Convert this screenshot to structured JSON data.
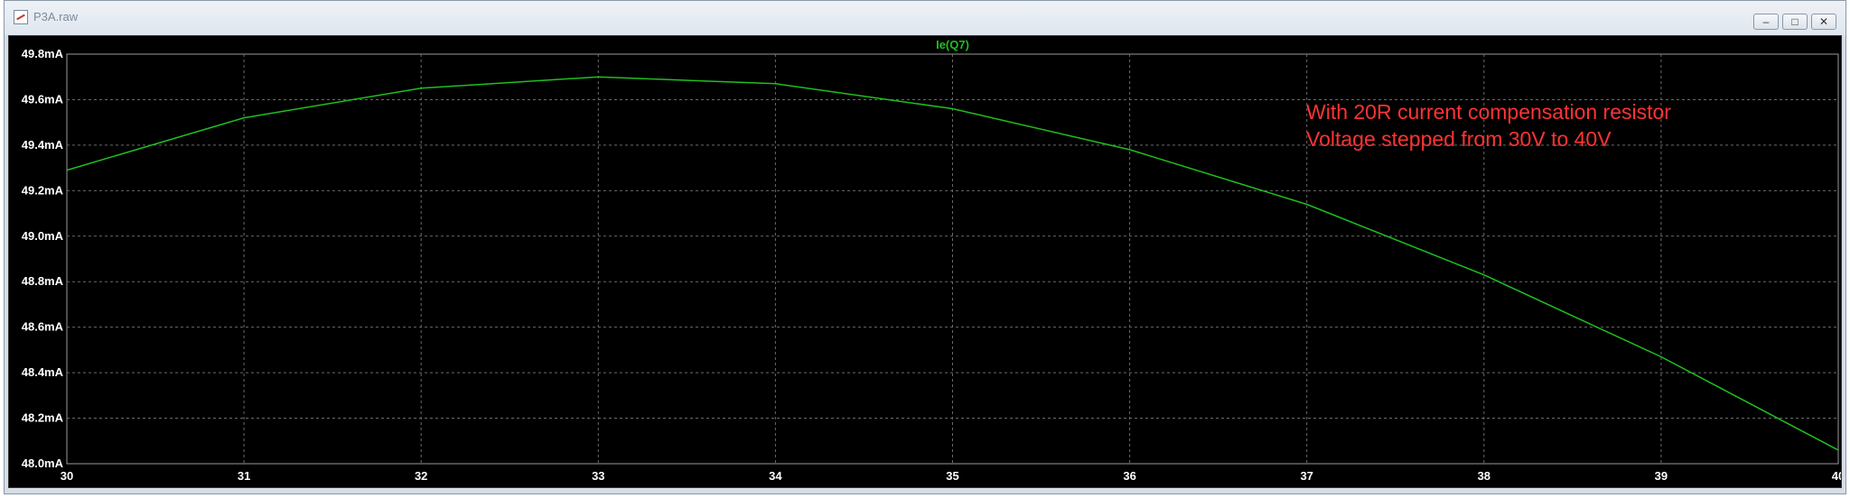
{
  "window": {
    "title": "P3A.raw",
    "minimize_label": "–",
    "maximize_label": "□",
    "close_label": "✕"
  },
  "colors": {
    "plot_background": "#000000",
    "trace": "#1fbf1f",
    "grid": "#6a6a6a",
    "axis_text": "#ffffff",
    "annotation": "#ff3333"
  },
  "annotation": {
    "line1": "With 20R current compensation resistor",
    "line2": "Voltage stepped from 30V to 40V"
  },
  "chart_data": {
    "type": "line",
    "title": "",
    "xlabel": "",
    "ylabel": "",
    "xlim": [
      30,
      40
    ],
    "ylim": [
      48.0,
      49.8
    ],
    "grid": true,
    "legend_placement": "top-center",
    "x_ticks": [
      "30",
      "31",
      "32",
      "33",
      "34",
      "35",
      "36",
      "37",
      "38",
      "39",
      "40"
    ],
    "y_ticks": [
      "49.8mA",
      "49.6mA",
      "49.4mA",
      "49.2mA",
      "49.0mA",
      "48.8mA",
      "48.6mA",
      "48.4mA",
      "48.2mA",
      "48.0mA"
    ],
    "series": [
      {
        "name": "Ie(Q7)",
        "x": [
          30,
          31,
          32,
          33,
          34,
          35,
          36,
          37,
          38,
          39,
          40
        ],
        "y": [
          49.29,
          49.52,
          49.65,
          49.7,
          49.67,
          49.56,
          49.38,
          49.14,
          48.83,
          48.47,
          48.06
        ]
      }
    ]
  }
}
